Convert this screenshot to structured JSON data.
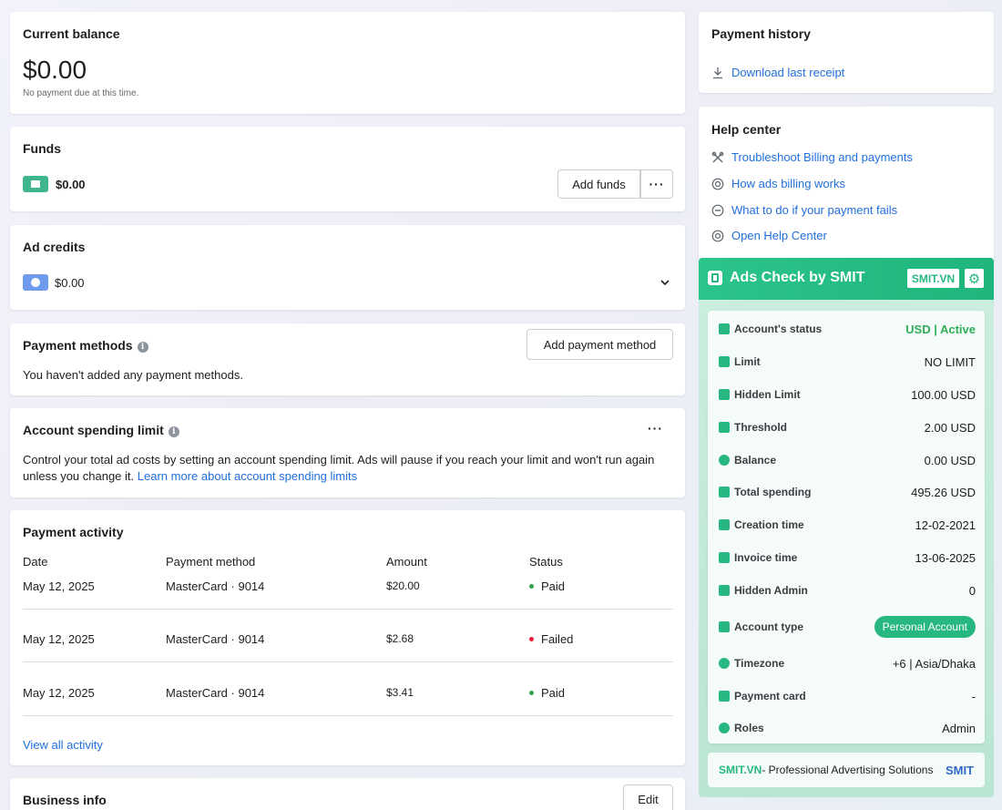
{
  "balance": {
    "title": "Current balance",
    "amount": "$0.00",
    "note": "No payment due at this time."
  },
  "funds": {
    "title": "Funds",
    "amount": "$0.00",
    "add_label": "Add funds",
    "more_label": "···"
  },
  "credits": {
    "title": "Ad credits",
    "amount": "$0.00",
    "chevron": "⌄"
  },
  "payment_methods": {
    "title": "Payment methods",
    "info": "i",
    "add_label": "Add payment method",
    "empty_text": "You haven't added any payment methods."
  },
  "spending_limit": {
    "title": "Account spending limit",
    "info": "i",
    "more_label": "···",
    "text": "Control your total ad costs by setting an account spending limit. Ads will pause if you reach your limit and won't run again unless you change it.",
    "link": "Learn more about account spending limits"
  },
  "activity": {
    "title": "Payment activity",
    "columns": [
      "Date",
      "Payment method",
      "Amount",
      "Status"
    ],
    "rows": [
      {
        "date": "May 12, 2025",
        "method": "MasterCard · 9014",
        "amount": "$20.00",
        "status": "Paid",
        "status_color": "#31a24c"
      },
      {
        "date": "May 12, 2025",
        "method": "MasterCard · 9014",
        "amount": "$2.68",
        "status": "Failed",
        "status_color": "#e41e3f"
      },
      {
        "date": "May 12, 2025",
        "method": "MasterCard · 9014",
        "amount": "$3.41",
        "status": "Paid",
        "status_color": "#31a24c"
      }
    ],
    "view_all": "View all activity"
  },
  "business": {
    "title": "Business info",
    "edit_label": "Edit"
  },
  "history": {
    "title": "Payment history",
    "download": "Download last receipt"
  },
  "help": {
    "title": "Help center",
    "links": [
      {
        "icon": "tools-icon",
        "label": "Troubleshoot Billing and payments"
      },
      {
        "icon": "billing-icon",
        "label": "How ads billing works"
      },
      {
        "icon": "minus-circle-icon",
        "label": "What to do if your payment fails"
      },
      {
        "icon": "lifebuoy-icon",
        "label": "Open Help Center"
      }
    ]
  },
  "smit": {
    "title": "Ads Check by SMIT",
    "badge": "SMIT.VN",
    "rows": [
      {
        "label": "Account's status",
        "value": "USD | Active"
      },
      {
        "label": "Limit",
        "value": "NO LIMIT"
      },
      {
        "label": "Hidden Limit",
        "value": "100.00 USD"
      },
      {
        "label": "Threshold",
        "value": "2.00 USD"
      },
      {
        "label": "Balance",
        "value": "0.00 USD"
      },
      {
        "label": "Total spending",
        "value": "495.26 USD"
      },
      {
        "label": "Creation time",
        "value": "12-02-2021"
      },
      {
        "label": "Invoice time",
        "value": "13-06-2025"
      },
      {
        "label": "Hidden Admin",
        "value": "0"
      },
      {
        "label": "Account type",
        "value": "Personal Account"
      },
      {
        "label": "Timezone",
        "value": "+6 | Asia/Dhaka"
      },
      {
        "label": "Payment card",
        "value": "-"
      },
      {
        "label": "Roles",
        "value": "Admin"
      }
    ],
    "footer_brand": "SMIT.VN",
    "footer_text": " - Professional Advertising Solutions",
    "footer_logo": "SMIT",
    "accent": "#27b780",
    "active_color": "#2eae5a"
  }
}
